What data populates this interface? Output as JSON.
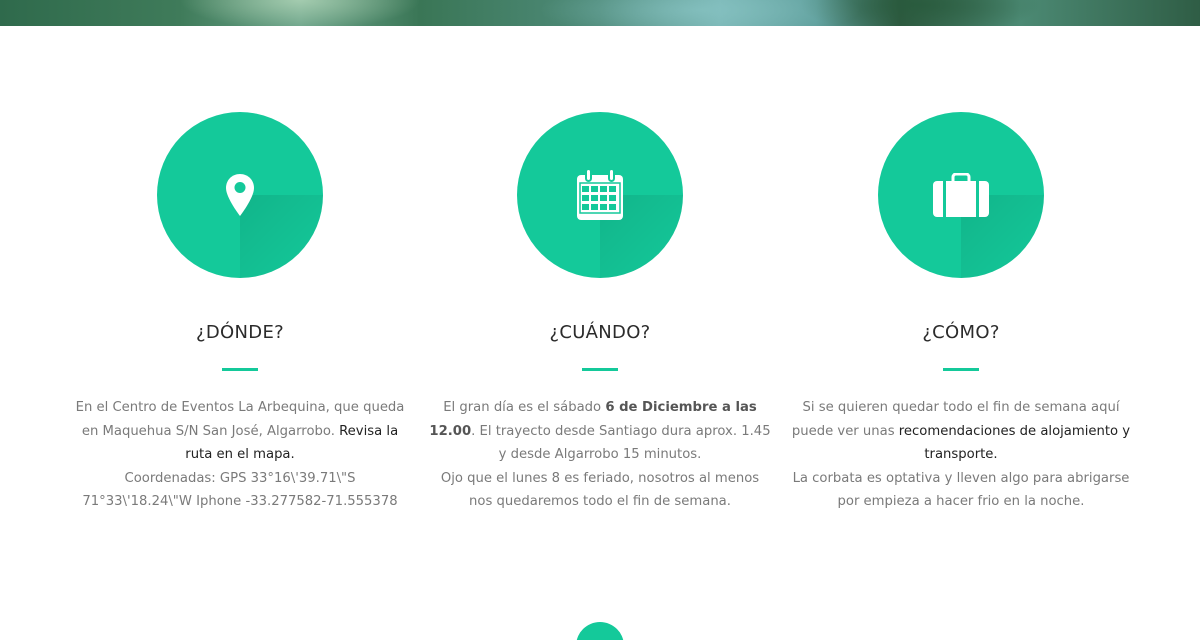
{
  "colors": {
    "accent": "#14c99a",
    "heading": "#2b2b2b",
    "body_text": "#7a7a7a"
  },
  "features": [
    {
      "icon": "map-pin-icon",
      "title": "¿DÓNDE?",
      "line1": "En el Centro de Eventos La Arbequina, que queda",
      "line2_prefix": "en Maquehua S/N San José, Algarrobo. ",
      "link_text_1": "Revisa la",
      "link_text_2": "ruta en el mapa.",
      "line4": "Coordenadas: GPS 33°16\\'39.71\\\"S",
      "line5": "71°33\\'18.24\\\"W Iphone -33.277582-71.555378"
    },
    {
      "icon": "calendar-icon",
      "title": "¿CUÁNDO?",
      "line1_prefix": "El gran día es el sábado ",
      "date_bold_1": "6 de Diciembre a las",
      "date_bold_2": "12.00",
      "line2_suffix": ". El trayecto desde Santiago dura aprox. 1.45",
      "line3": "y desde Algarrobo 15 minutos.",
      "line4": "Ojo que el lunes 8 es feriado, nosotros al menos",
      "line5": "nos quedaremos todo el fin de semana."
    },
    {
      "icon": "suitcase-icon",
      "title": "¿CÓMO?",
      "line1": "Si se quieren quedar todo el fin de semana aquí",
      "line2_prefix": "puede ver unas ",
      "link_text_1": "recomendaciones de alojamiento y",
      "link_text_2": "transporte.",
      "line4": "La corbata es optativa y lleven algo para abrigarse",
      "line5": "por empieza a hacer frio en la noche."
    }
  ],
  "scroll_button": {
    "icon": "chevron-down-icon"
  }
}
